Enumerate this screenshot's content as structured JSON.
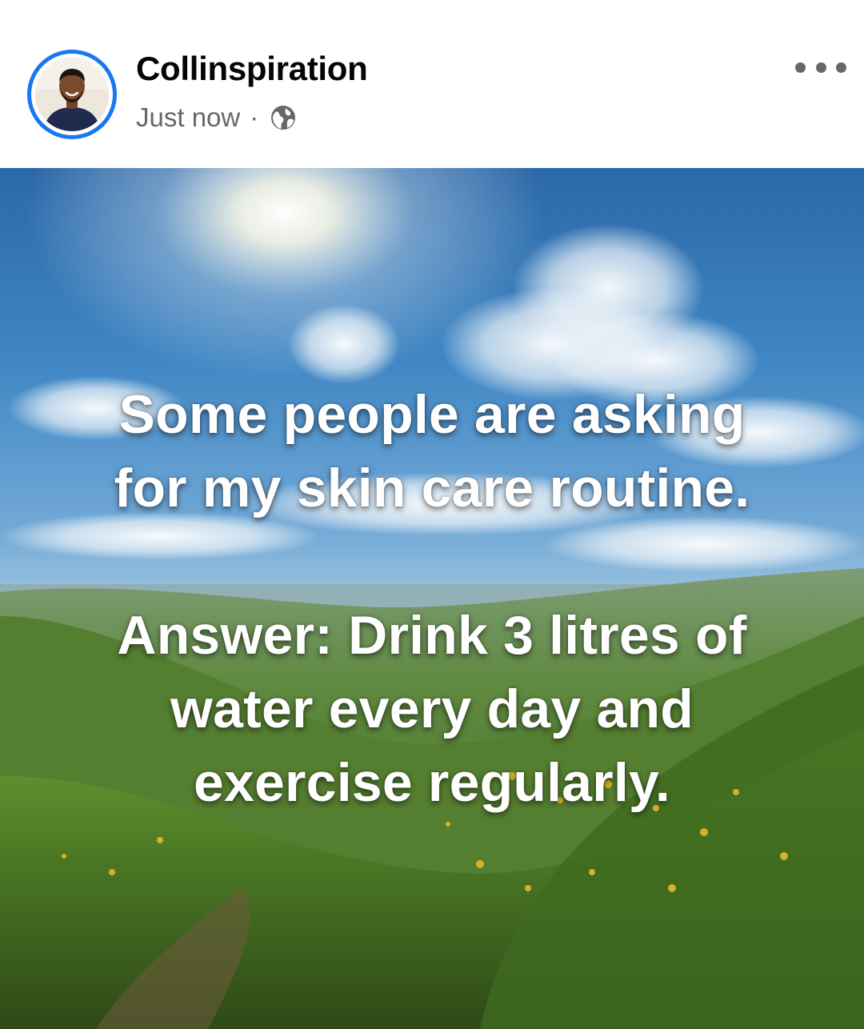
{
  "post": {
    "author": "Collinspiration",
    "timestamp": "Just now",
    "separator": "·",
    "privacy_icon": "globe-icon",
    "avatar_icon": "profile-photo",
    "menu_icon": "more-options-icon"
  },
  "image": {
    "quote_line1": "Some people are asking",
    "quote_line2": "for my skin care routine.",
    "answer_line1": "Answer: Drink 3 litres of",
    "answer_line2": "water every day and",
    "answer_line3": "exercise regularly."
  },
  "colors": {
    "accent": "#1877f2",
    "name_text": "#050505",
    "meta_text": "#65676b",
    "sky_top": "#2f6fb0",
    "sky_horizon": "#cfe3f0",
    "grass": "#4f7a2a"
  }
}
